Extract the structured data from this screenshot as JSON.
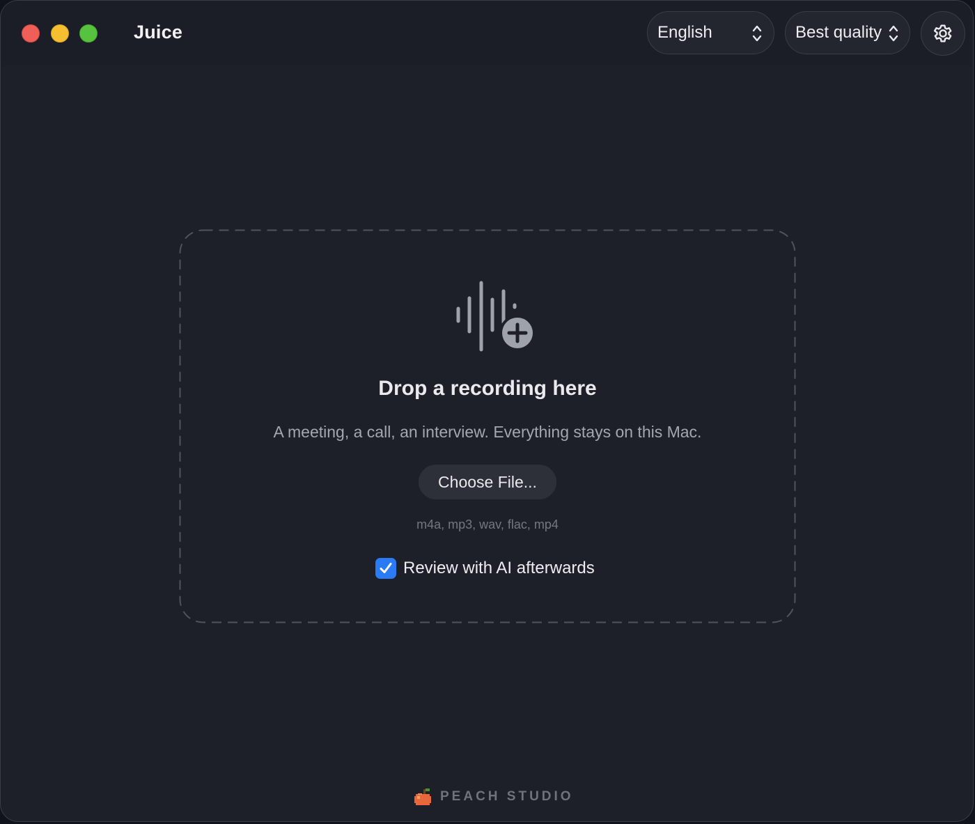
{
  "window": {
    "title": "Juice"
  },
  "toolbar": {
    "language": {
      "selected": "English",
      "icon": "chevron-up-down-icon"
    },
    "quality": {
      "selected": "Best quality",
      "icon": "chevron-up-down-icon"
    },
    "settings_icon": "gear-icon"
  },
  "drop_zone": {
    "icon": "waveform-add-icon",
    "title": "Drop a recording here",
    "subtitle": "A meeting, a call, an interview. Everything stays on this Mac.",
    "choose_button_label": "Choose File...",
    "formats": "m4a, mp3, wav, flac, mp4",
    "review_checkbox": {
      "label": "Review with AI afterwards",
      "checked": true
    }
  },
  "footer": {
    "icon": "peach-icon",
    "text": "PEACH STUDIO"
  },
  "colors": {
    "background": "#1e2029",
    "accent": "#2b7bf6",
    "close": "#ee5f57",
    "minimize": "#f5bf2f",
    "maximize": "#57c23e",
    "peach": "#e8683a"
  }
}
